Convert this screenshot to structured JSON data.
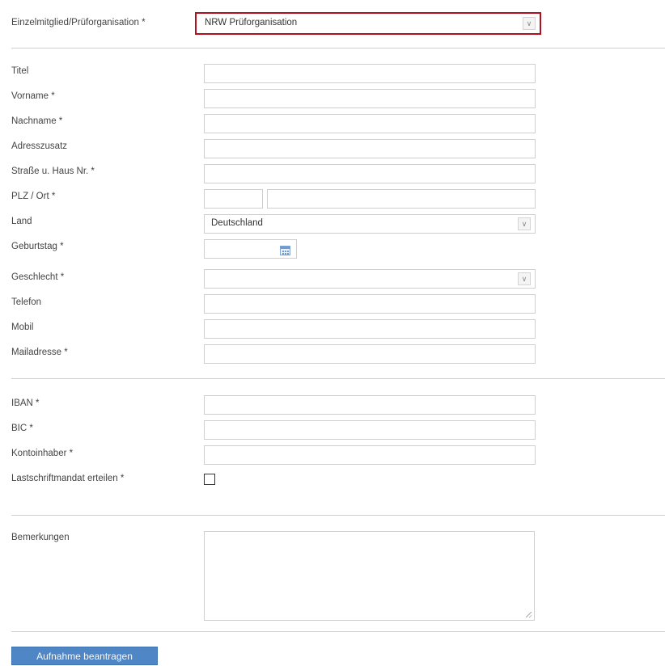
{
  "membership": {
    "label": "Einzelmitglied/Prüforganisation *",
    "selected": "NRW Prüforganisation"
  },
  "personal": {
    "titel": "Titel",
    "vorname": "Vorname *",
    "nachname": "Nachname *",
    "adresszusatz": "Adresszusatz",
    "strasse": "Straße u. Haus Nr. *",
    "plz_ort": "PLZ / Ort *",
    "land": "Land",
    "land_value": "Deutschland",
    "geburtstag": "Geburtstag *",
    "geschlecht": "Geschlecht *",
    "geschlecht_value": "",
    "telefon": "Telefon",
    "mobil": "Mobil",
    "mailadresse": "Mailadresse *"
  },
  "bank": {
    "iban": "IBAN *",
    "bic": "BIC *",
    "kontoinhaber": "Kontoinhaber *",
    "lastschrift": "Lastschriftmandat erteilen *"
  },
  "remarks": {
    "label": "Bemerkungen"
  },
  "submit": {
    "label": "Aufnahme beantragen"
  },
  "icons": {
    "dropdown": "chevron-down-icon",
    "calendar": "calendar-icon"
  },
  "colors": {
    "highlight_border": "#b01020",
    "button_bg": "#4f86c6"
  }
}
